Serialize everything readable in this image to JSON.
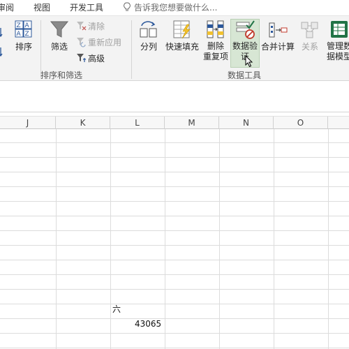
{
  "tabs": [
    "审阅",
    "视图",
    "开发工具"
  ],
  "tell_me": "告诉我您想要做什么...",
  "sort_filter": {
    "sort_label": "排序",
    "filter_label": "筛选",
    "clear_label": "清除",
    "reapply_label": "重新应用",
    "advanced_label": "高级",
    "group_label": "排序和筛选"
  },
  "data_tools": {
    "split_label": "分列",
    "flash_fill_label": "快速填充",
    "remove_dup_label_1": "删除",
    "remove_dup_label_2": "重复项",
    "validation_label_1": "数据验",
    "validation_label_2": "证",
    "consolidate_label": "合并计算",
    "relationships_label": "关系",
    "manage_model_label_1": "管理数",
    "manage_model_label_2": "据模型",
    "group_label": "数据工具"
  },
  "columns": [
    "J",
    "K",
    "L",
    "M",
    "N",
    "O"
  ],
  "cells": {
    "l_row_a": "六",
    "l_row_b": "43065"
  },
  "colors": {
    "ribbon_bg": "#f3f3f3",
    "hover_highlight": "#d7e6d4",
    "accent_green": "#217346"
  }
}
